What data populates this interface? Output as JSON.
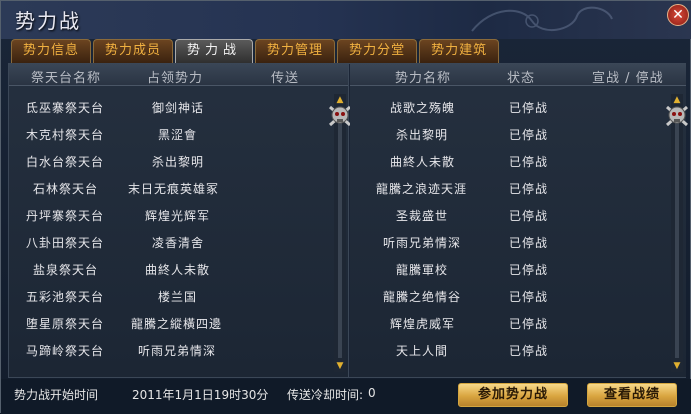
{
  "window": {
    "title": "势力战",
    "close_symbol": "✕"
  },
  "tabs": [
    {
      "label": "势力信息"
    },
    {
      "label": "势力成员"
    },
    {
      "label": "势力战"
    },
    {
      "label": "势力管理"
    },
    {
      "label": "势力分堂"
    },
    {
      "label": "势力建筑"
    }
  ],
  "left_table": {
    "headers": [
      "祭天台名称",
      "占领势力",
      "传送"
    ],
    "rows": [
      {
        "altar": "氐巫寨祭天台",
        "faction": "御剑神话"
      },
      {
        "altar": "木克村祭天台",
        "faction": "黑涩會"
      },
      {
        "altar": "白水台祭天台",
        "faction": "杀出黎明"
      },
      {
        "altar": "石林祭天台",
        "faction": "末日无痕英雄冢"
      },
      {
        "altar": "丹坪寨祭天台",
        "faction": "辉煌光辉军"
      },
      {
        "altar": "八卦田祭天台",
        "faction": "凌香清舍"
      },
      {
        "altar": "盐泉祭天台",
        "faction": "曲終人未散"
      },
      {
        "altar": "五彩池祭天台",
        "faction": "楼兰国"
      },
      {
        "altar": "堕星原祭天台",
        "faction": "龍騰之縱橫四邊"
      },
      {
        "altar": "马蹄岭祭天台",
        "faction": "听雨兄弟情深"
      }
    ]
  },
  "right_table": {
    "headers": [
      "势力名称",
      "状态",
      "宣战 / 停战"
    ],
    "rows": [
      {
        "faction": "战歌之殇魄",
        "status": "已停战"
      },
      {
        "faction": "杀出黎明",
        "status": "已停战"
      },
      {
        "faction": "曲終人未散",
        "status": "已停战"
      },
      {
        "faction": "龍騰之浪迹天涯",
        "status": "已停战"
      },
      {
        "faction": "圣裁盛世",
        "status": "已停战"
      },
      {
        "faction": "听雨兄弟情深",
        "status": "已停战"
      },
      {
        "faction": "龍騰軍校",
        "status": "已停战"
      },
      {
        "faction": "龍騰之绝情谷",
        "status": "已停战"
      },
      {
        "faction": "辉煌虎威军",
        "status": "已停战"
      },
      {
        "faction": "天上人間",
        "status": "已停战"
      }
    ]
  },
  "footer": {
    "start_time_label": "势力战开始时间",
    "start_time_value": "2011年1月1日19时30分",
    "cooldown_label": "传送冷却时间:",
    "cooldown_value": "0",
    "join_button": "参加势力战",
    "view_button": "查看战绩"
  },
  "icons": {
    "scroll_up": "▲",
    "scroll_down": "▼"
  },
  "colors": {
    "tab_text": "#f0b040",
    "button_gold": "#d9a540",
    "close_red": "#c0392b"
  }
}
